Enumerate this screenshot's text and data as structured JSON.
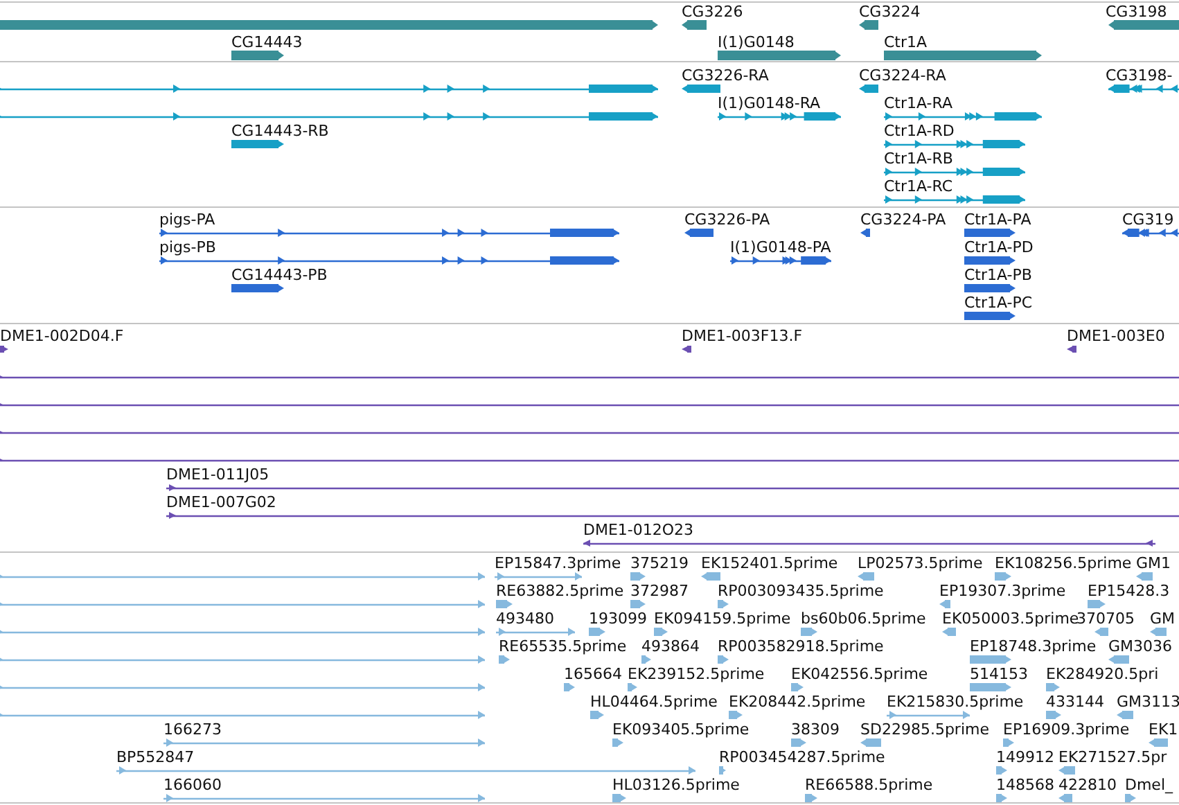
{
  "tracks": [
    {
      "kind": "gene",
      "color": "#3a8f96",
      "features": [
        {
          "reverse": false
        },
        {
          "label": "CG3226",
          "reverse": true
        },
        {
          "label": "CG3224",
          "reverse": true
        },
        {
          "label": "CG3198",
          "reverse": true
        },
        {
          "label": "CG14443",
          "reverse": false
        },
        {
          "label": "I(1)G0148",
          "reverse": false
        },
        {
          "label": "Ctr1A",
          "reverse": false
        }
      ]
    },
    {
      "kind": "transcript",
      "color": "#17a0c6",
      "features": [
        {
          "reverse": false
        },
        {
          "label": "CG3226-RA",
          "reverse": true
        },
        {
          "label": "CG3224-RA",
          "reverse": true
        },
        {
          "label": "CG3198-",
          "reverse": true
        },
        {
          "reverse": false
        },
        {
          "label": "I(1)G0148-RA",
          "reverse": false
        },
        {
          "label": "Ctr1A-RA",
          "reverse": false
        },
        {
          "label": "CG14443-RB",
          "reverse": false
        },
        {
          "label": "Ctr1A-RD",
          "reverse": false
        },
        {
          "label": "Ctr1A-RB",
          "reverse": false
        },
        {
          "label": "Ctr1A-RC",
          "reverse": false
        }
      ]
    },
    {
      "kind": "protein",
      "color": "#2c6cd3",
      "features": [
        {
          "label": "pigs-PA",
          "reverse": false
        },
        {
          "label": "CG3226-PA",
          "reverse": true
        },
        {
          "label": "CG3224-PA",
          "reverse": true
        },
        {
          "label": "Ctr1A-PA",
          "reverse": false
        },
        {
          "label": "CG319",
          "reverse": true
        },
        {
          "label": "pigs-PB",
          "reverse": false
        },
        {
          "label": "I(1)G0148-PA",
          "reverse": false
        },
        {
          "label": "Ctr1A-PD",
          "reverse": false
        },
        {
          "label": "CG14443-PB",
          "reverse": false
        },
        {
          "label": "Ctr1A-PB",
          "reverse": false
        },
        {
          "label": "Ctr1A-PC",
          "reverse": false
        }
      ]
    },
    {
      "kind": "clone",
      "color": "#6b4fb2",
      "features": [
        {
          "label": "DME1-002D04.F",
          "reverse": false
        },
        {
          "label": "DME1-003F13.F",
          "reverse": true
        },
        {
          "label": "DME1-003E0",
          "reverse": true
        },
        {
          "reverse": false
        },
        {
          "reverse": false
        },
        {
          "reverse": false
        },
        {
          "reverse": false
        },
        {
          "label": "DME1-011J05",
          "reverse": false
        },
        {
          "label": "DME1-007G02",
          "reverse": false
        },
        {
          "label": "DME1-012O23",
          "reverse": true
        }
      ]
    },
    {
      "kind": "est",
      "color": "#86b9de",
      "features": [
        {
          "reverse": false
        },
        {
          "label": "EP15847.3prime",
          "reverse": false
        },
        {
          "label": "375219",
          "reverse": false
        },
        {
          "label": "EK152401.5prime",
          "reverse": true
        },
        {
          "label": "LP02573.5prime",
          "reverse": true
        },
        {
          "label": "EK108256.5prime",
          "reverse": false
        },
        {
          "label": "GM1",
          "reverse": true
        },
        {
          "reverse": false
        },
        {
          "label": "RE63882.5prime",
          "reverse": false
        },
        {
          "label": "372987",
          "reverse": false
        },
        {
          "label": "RP003093435.5prime",
          "reverse": false
        },
        {
          "label": "EP19307.3prime",
          "reverse": true
        },
        {
          "label": "EP15428.3",
          "reverse": false
        },
        {
          "reverse": false
        },
        {
          "label": "493480",
          "reverse": false
        },
        {
          "label": "193099",
          "reverse": false
        },
        {
          "label": "EK094159.5prime",
          "reverse": false
        },
        {
          "label": "bs60b06.5prime",
          "reverse": false
        },
        {
          "label": "EK050003.5prime",
          "reverse": true
        },
        {
          "label": "370705",
          "reverse": true
        },
        {
          "label": "GM",
          "reverse": true
        },
        {
          "reverse": false
        },
        {
          "label": "RE65535.5prime",
          "reverse": false
        },
        {
          "label": "493864",
          "reverse": false
        },
        {
          "label": "RP003582918.5prime",
          "reverse": false
        },
        {
          "label": "EP18748.3prime",
          "reverse": false
        },
        {
          "label": "GM3036",
          "reverse": true
        },
        {
          "reverse": false
        },
        {
          "label": "165664",
          "reverse": false
        },
        {
          "label": "EK239152.5prime",
          "reverse": false
        },
        {
          "label": "EK042556.5prime",
          "reverse": false
        },
        {
          "label": "514153",
          "reverse": false
        },
        {
          "label": "EK284920.5pri",
          "reverse": false
        },
        {
          "reverse": false
        },
        {
          "label": "HL04464.5prime",
          "reverse": false
        },
        {
          "label": "EK208442.5prime",
          "reverse": false
        },
        {
          "label": "EK215830.5prime",
          "reverse": false
        },
        {
          "label": "433144",
          "reverse": false
        },
        {
          "label": "GM3113",
          "reverse": true
        },
        {
          "label": "166273",
          "reverse": false
        },
        {
          "label": "EK093405.5prime",
          "reverse": false
        },
        {
          "label": "38309",
          "reverse": false
        },
        {
          "label": "SD22985.5prime",
          "reverse": true
        },
        {
          "label": "EP16909.3prime",
          "reverse": false
        },
        {
          "label": "EK1",
          "reverse": true
        },
        {
          "label": "BP552847",
          "reverse": false
        },
        {
          "label": "RP003454287.5prime",
          "reverse": false
        },
        {
          "label": "149912",
          "reverse": false
        },
        {
          "label": "EK271527.5pr",
          "reverse": true
        },
        {
          "label": "166060",
          "reverse": false
        },
        {
          "label": "HL03126.5prime",
          "reverse": false
        },
        {
          "label": "RE66588.5prime",
          "reverse": false
        },
        {
          "label": "148568",
          "reverse": false
        },
        {
          "label": "422810",
          "reverse": true
        },
        {
          "label": "Dmel_",
          "reverse": false
        }
      ]
    }
  ]
}
